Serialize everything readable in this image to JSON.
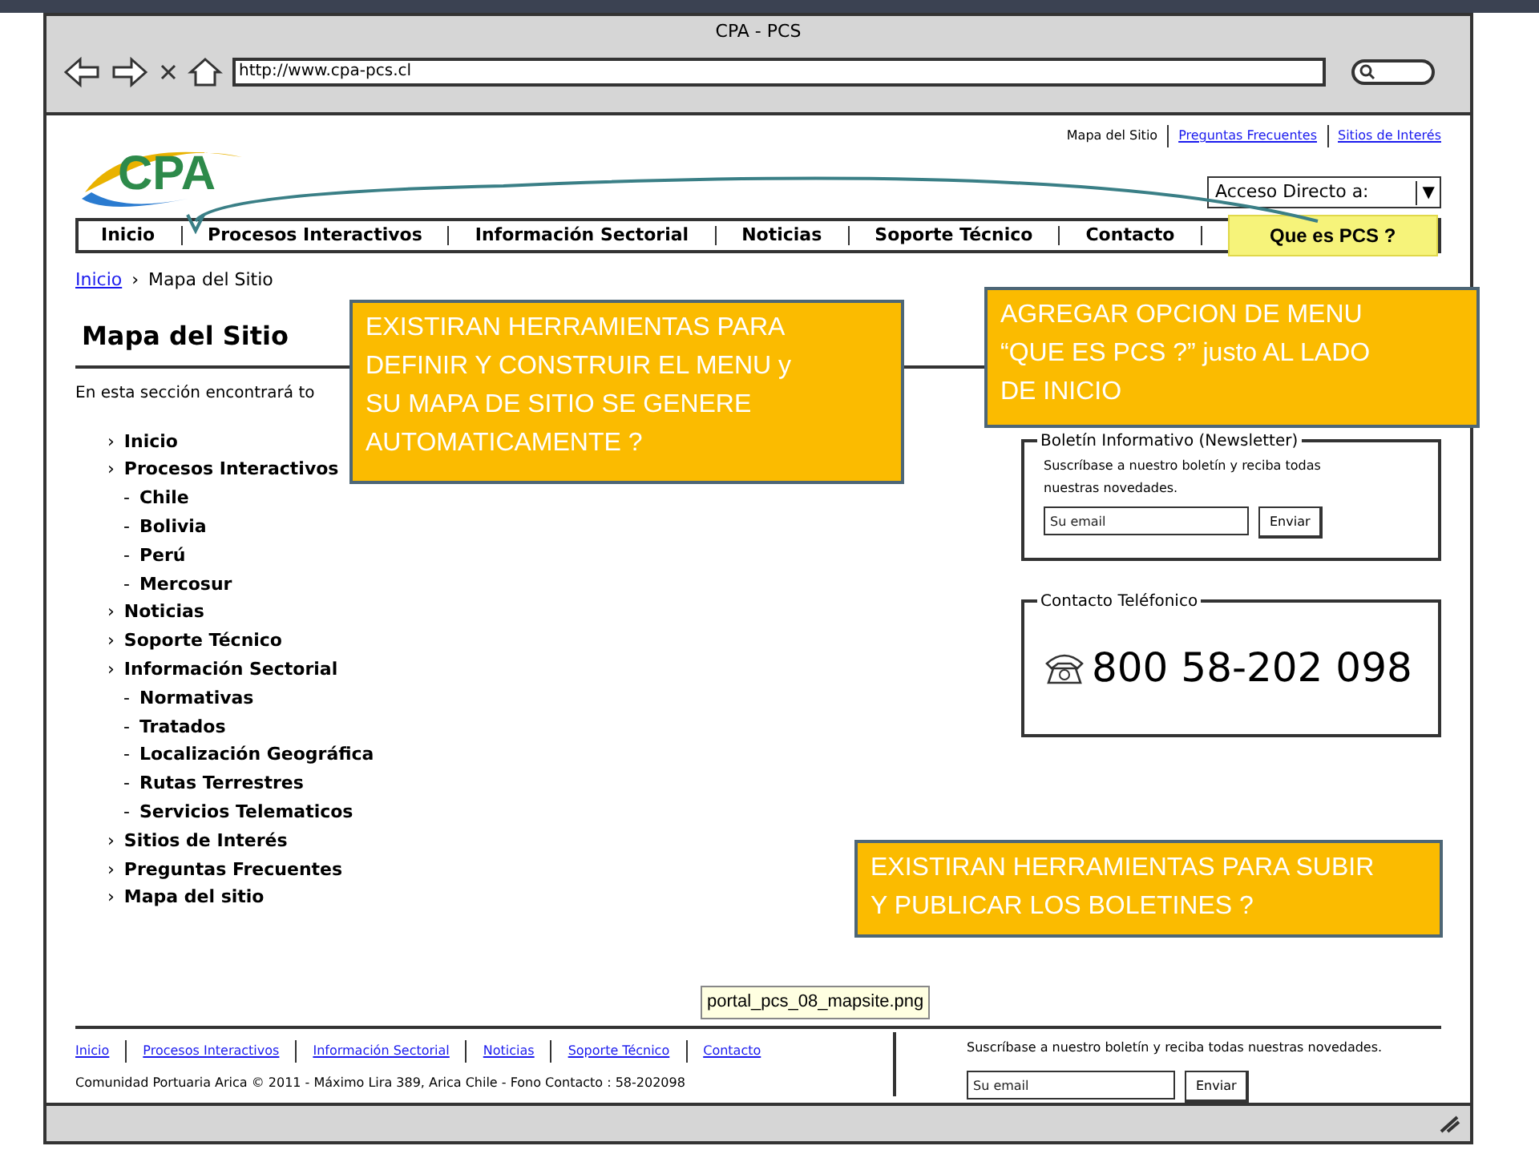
{
  "window": {
    "title": "CPA - PCS",
    "url": "http://www.cpa-pcs.cl"
  },
  "top_links": [
    {
      "label": "Mapa del Sitio",
      "link": false
    },
    {
      "label": "Preguntas Frecuentes",
      "link": true
    },
    {
      "label": "Sitios de Interés",
      "link": true
    }
  ],
  "logo": {
    "text": "CPA"
  },
  "quick_access": {
    "label": "Acceso Directo a:",
    "arrow": "▼"
  },
  "nav": [
    {
      "label": "Inicio",
      "highlighted": false
    },
    {
      "label": "Procesos Interactivos",
      "highlighted": false
    },
    {
      "label": "Información Sectorial",
      "highlighted": false
    },
    {
      "label": "Noticias",
      "highlighted": false
    },
    {
      "label": "Soporte Técnico",
      "highlighted": false
    },
    {
      "label": "Contacto",
      "highlighted": false
    },
    {
      "label": "Que es PCS ?",
      "highlighted": true
    }
  ],
  "breadcrumb": {
    "link": "Inicio",
    "separator": "›",
    "current": "Mapa del Sitio"
  },
  "page_title": "Mapa del Sitio",
  "intro": "En esta sección encontrará to",
  "sitemap": [
    {
      "bullet": "›",
      "label": "Inicio"
    },
    {
      "bullet": "›",
      "label": "Procesos Interactivos",
      "children": [
        {
          "bullet": "-",
          "label": "Chile"
        },
        {
          "bullet": "-",
          "label": "Bolivia"
        },
        {
          "bullet": "-",
          "label": "Perú"
        },
        {
          "bullet": "-",
          "label": "Mercosur"
        }
      ]
    },
    {
      "bullet": "›",
      "label": "Noticias"
    },
    {
      "bullet": "›",
      "label": "Soporte Técnico"
    },
    {
      "bullet": "›",
      "label": "Información Sectorial",
      "children": [
        {
          "bullet": "-",
          "label": "Normativas"
        },
        {
          "bullet": "-",
          "label": "Tratados"
        },
        {
          "bullet": "-",
          "label": "Localización Geográfica"
        },
        {
          "bullet": "-",
          "label": "Rutas Terrestres"
        },
        {
          "bullet": "-",
          "label": "Servicios Telematicos"
        }
      ]
    },
    {
      "bullet": "›",
      "label": "Sitios de Interés"
    },
    {
      "bullet": "›",
      "label": "Preguntas Frecuentes"
    },
    {
      "bullet": "›",
      "label": "Mapa del sitio"
    }
  ],
  "newsletter": {
    "title": "Boletín Informativo (Newsletter)",
    "text": "Suscríbase a nuestro boletín y reciba todas nuestras novedades.",
    "placeholder": "Su email",
    "button": "Enviar"
  },
  "contact": {
    "title": "Contacto Teléfonico",
    "phone": "800 58-202 098"
  },
  "footer": {
    "links": [
      "Inicio",
      "Procesos Interactivos",
      "Información Sectorial",
      "Noticias",
      "Soporte Técnico",
      "Contacto"
    ],
    "copyright": "Comunidad Portuaria Arica © 2011 - Máximo Lira 389, Arica Chile - Fono Contacto : 58-202098",
    "newsletter_text": "Suscríbase a nuestro boletín y reciba todas nuestras novedades.",
    "placeholder": "Su email",
    "button": "Enviar"
  },
  "tooltip": "portal_pcs_08_mapsite.png",
  "notes": [
    {
      "text": "EXISTIRAN HERRAMIENTAS  PARA DEFINIR Y CONSTRUIR EL MENU y SU MAPA DE SITIO SE GENERE AUTOMATICAMENTE ?"
    },
    {
      "text": "AGREGAR OPCION DE MENU “QUE ES PCS ?” justo AL LADO DE INICIO"
    },
    {
      "text": "EXISTIRAN HERRAMIENTAS  PARA SUBIR Y PUBLICAR LOS BOLETINES ?"
    }
  ]
}
